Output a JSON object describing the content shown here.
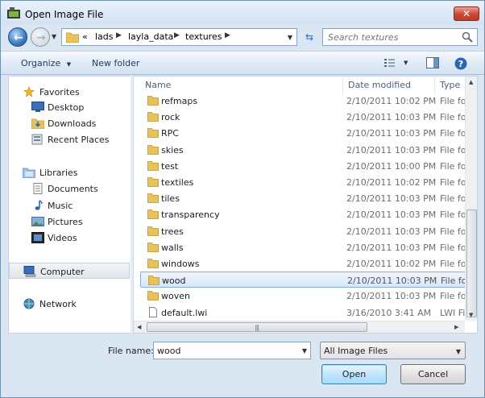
{
  "window": {
    "title": "Open Image File",
    "close_glyph": "✕"
  },
  "address": {
    "overflow": "«",
    "crumbs": [
      "lads",
      "layla_data",
      "textures"
    ],
    "separator": "▶"
  },
  "search": {
    "placeholder": "Search textures"
  },
  "toolbar": {
    "organize": "Organize",
    "new_folder": "New folder"
  },
  "nav": {
    "favorites": "Favorites",
    "desktop": "Desktop",
    "downloads": "Downloads",
    "recent_places": "Recent Places",
    "libraries": "Libraries",
    "documents": "Documents",
    "music": "Music",
    "pictures": "Pictures",
    "videos": "Videos",
    "computer": "Computer",
    "network": "Network"
  },
  "columns": {
    "name": "Name",
    "date": "Date modified",
    "type": "Type"
  },
  "files": [
    {
      "name": "refmaps",
      "date": "2/10/2011 10:02 PM",
      "type": "File folder",
      "kind": "folder"
    },
    {
      "name": "rock",
      "date": "2/10/2011 10:03 PM",
      "type": "File folder",
      "kind": "folder"
    },
    {
      "name": "RPC",
      "date": "2/10/2011 10:03 PM",
      "type": "File folder",
      "kind": "folder"
    },
    {
      "name": "skies",
      "date": "2/10/2011 10:03 PM",
      "type": "File folder",
      "kind": "folder"
    },
    {
      "name": "test",
      "date": "2/10/2011 10:00 PM",
      "type": "File folder",
      "kind": "folder"
    },
    {
      "name": "textiles",
      "date": "2/10/2011 10:02 PM",
      "type": "File folder",
      "kind": "folder"
    },
    {
      "name": "tiles",
      "date": "2/10/2011 10:03 PM",
      "type": "File folder",
      "kind": "folder"
    },
    {
      "name": "transparency",
      "date": "2/10/2011 10:03 PM",
      "type": "File folder",
      "kind": "folder"
    },
    {
      "name": "trees",
      "date": "2/10/2011 10:03 PM",
      "type": "File folder",
      "kind": "folder"
    },
    {
      "name": "walls",
      "date": "2/10/2011 10:03 PM",
      "type": "File folder",
      "kind": "folder"
    },
    {
      "name": "windows",
      "date": "2/10/2011 10:02 PM",
      "type": "File folder",
      "kind": "folder"
    },
    {
      "name": "wood",
      "date": "2/10/2011 10:03 PM",
      "type": "File folder",
      "kind": "folder",
      "selected": true
    },
    {
      "name": "woven",
      "date": "2/10/2011 10:03 PM",
      "type": "File folder",
      "kind": "folder"
    },
    {
      "name": "default.lwi",
      "date": "3/16/2010 3:41 AM",
      "type": "LWI File",
      "kind": "file"
    }
  ],
  "bottom": {
    "file_name_label": "File name:",
    "file_name_value": "wood",
    "filter": "All Image Files",
    "open": "Open",
    "cancel": "Cancel"
  },
  "colors": {
    "accent": "#3c7fb1",
    "selection": "#84acdd",
    "folder": "#e8c25a"
  }
}
